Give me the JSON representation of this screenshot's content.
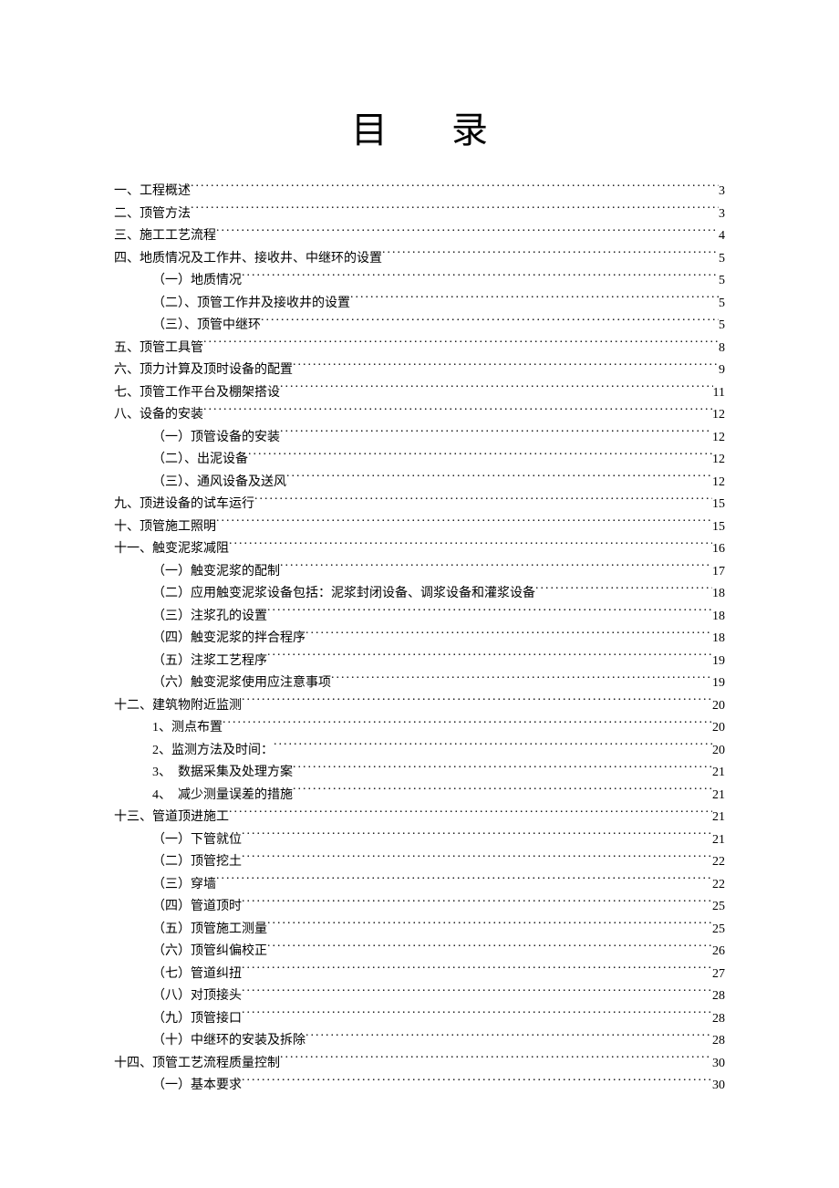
{
  "title": "目录",
  "toc": [
    {
      "level": 1,
      "label": "一、工程概述",
      "page": "3"
    },
    {
      "level": 1,
      "label": "二、顶管方法",
      "page": "3"
    },
    {
      "level": 1,
      "label": "三、施工工艺流程",
      "page": "4"
    },
    {
      "level": 1,
      "label": "四、地质情况及工作井、接收井、中继环的设置",
      "page": "5"
    },
    {
      "level": 2,
      "label": "（一）地质情况",
      "page": "5"
    },
    {
      "level": 2,
      "label": "（二）、顶管工作井及接收井的设置",
      "page": "5"
    },
    {
      "level": 2,
      "label": "（三）、顶管中继环",
      "page": "5"
    },
    {
      "level": 1,
      "label": "五、顶管工具管",
      "page": "8"
    },
    {
      "level": 1,
      "label": "六、顶力计算及顶时设备的配置",
      "page": "9"
    },
    {
      "level": 1,
      "label": "七、顶管工作平台及棚架搭设",
      "page": "11"
    },
    {
      "level": 1,
      "label": "八、设备的安装",
      "page": "12"
    },
    {
      "level": 2,
      "label": "（一）顶管设备的安装",
      "page": "12"
    },
    {
      "level": 2,
      "label": "（二）、出泥设备",
      "page": "12"
    },
    {
      "level": 2,
      "label": "（三）、通风设备及送风",
      "page": "12"
    },
    {
      "level": 1,
      "label": "九、顶进设备的试车运行",
      "page": "15"
    },
    {
      "level": 1,
      "label": "十、顶管施工照明",
      "page": "15"
    },
    {
      "level": 1,
      "label": "十一、触变泥浆减阻",
      "page": "16"
    },
    {
      "level": 2,
      "label": "（一）触变泥浆的配制",
      "page": "17"
    },
    {
      "level": 2,
      "label": "（二）应用触变泥浆设备包括：泥浆封闭设备、调浆设备和灌浆设备",
      "page": "18"
    },
    {
      "level": 2,
      "label": "（三）注浆孔的设置",
      "page": "18"
    },
    {
      "level": 2,
      "label": "（四）触变泥浆的拌合程序",
      "page": "18"
    },
    {
      "level": 2,
      "label": "（五）注浆工艺程序",
      "page": "19"
    },
    {
      "level": 2,
      "label": "（六）触变泥浆使用应注意事项",
      "page": "19"
    },
    {
      "level": 1,
      "label": "十二、建筑物附近监测",
      "page": "20"
    },
    {
      "level": 2,
      "label": "1、测点布置",
      "page": "20"
    },
    {
      "level": 2,
      "label": "2、监测方法及时间：",
      "page": "20"
    },
    {
      "level": 2,
      "label": "3、　数据采集及处理方案",
      "page": "21"
    },
    {
      "level": 2,
      "label": "4、　减少测量误差的措施",
      "page": "21"
    },
    {
      "level": 1,
      "label": "十三、管道顶进施工",
      "page": "21"
    },
    {
      "level": 2,
      "label": "（一）下管就位",
      "page": "21"
    },
    {
      "level": 2,
      "label": "（二）顶管挖土",
      "page": "22"
    },
    {
      "level": 2,
      "label": "（三）穿墙",
      "page": "22"
    },
    {
      "level": 2,
      "label": "（四）管道顶时",
      "page": "25"
    },
    {
      "level": 2,
      "label": "（五）顶管施工测量",
      "page": "25"
    },
    {
      "level": 2,
      "label": "（六）顶管纠偏校正",
      "page": "26"
    },
    {
      "level": 2,
      "label": "（七）管道纠扭",
      "page": "27"
    },
    {
      "level": 2,
      "label": "（八）对顶接头",
      "page": "28"
    },
    {
      "level": 2,
      "label": "（九）顶管接口",
      "page": "28"
    },
    {
      "level": 2,
      "label": "（十）中继环的安装及拆除",
      "page": "28"
    },
    {
      "level": 1,
      "label": "十四、顶管工艺流程质量控制",
      "page": "30"
    },
    {
      "level": 2,
      "label": "（一）基本要求",
      "page": "30"
    }
  ]
}
